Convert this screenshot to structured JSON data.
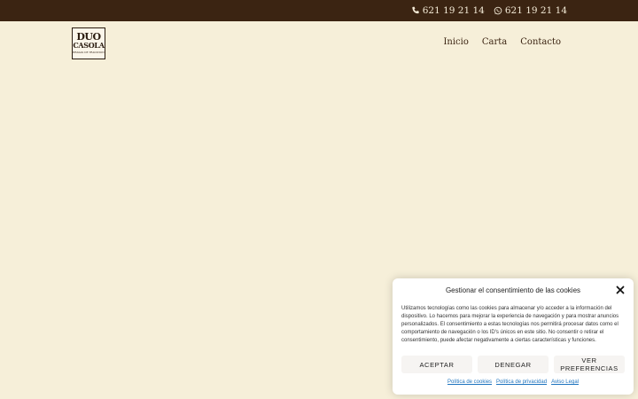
{
  "topbar": {
    "phone_text": "621 19 21 14",
    "whatsapp_text": "621 19 21 14",
    "background": "#3b2412",
    "phone_icon": "phone-icon",
    "whatsapp_icon": "whatsapp-icon"
  },
  "logo": {
    "line1": "DUO",
    "line2": "CASOLA",
    "line3": "BRASAS DE TRADICION"
  },
  "nav": {
    "items": [
      {
        "label": "Inicio"
      },
      {
        "label": "Carta"
      },
      {
        "label": "Contacto"
      }
    ]
  },
  "page": {
    "background": "#f6efd9"
  },
  "cookie_banner": {
    "title": "Gestionar el consentimiento de las cookies",
    "body": "Utilizamos tecnologías como las cookies para almacenar y/o acceder a la información del dispositivo. Lo hacemos para mejorar la experiencia de navegación y para mostrar anuncios personalizados. El consentimiento a estas tecnologías nos permitirá procesar datos como el comportamiento de navegación o los ID's únicos en este sitio. No consentir o retirar el consentimiento, puede afectar negativamente a ciertas características y funciones.",
    "buttons": {
      "accept": "ACEPTAR",
      "deny": "DENEGAR",
      "preferences": "VER PREFERENCIAS"
    },
    "links": {
      "cookies": "Política de cookies",
      "privacy": "Política de privacidad",
      "legal": "Aviso Legal"
    },
    "close_icon": "close-icon",
    "link_color": "#1e73be"
  }
}
